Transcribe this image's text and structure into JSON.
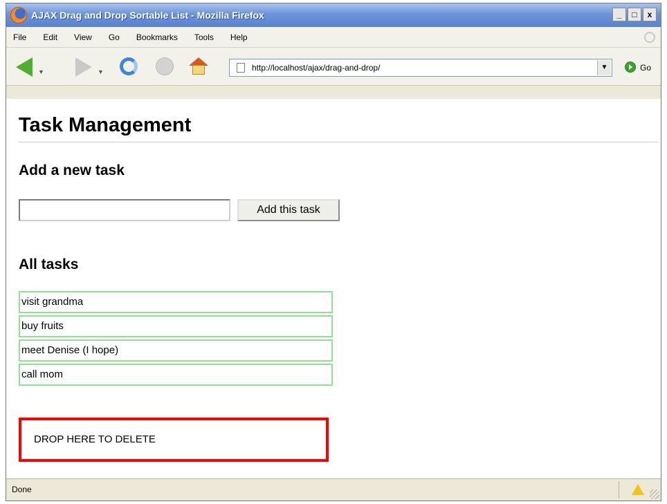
{
  "window": {
    "title": "AJAX Drag and Drop Sortable List - Mozilla Firefox",
    "minimize": "_",
    "maximize": "□",
    "close": "x"
  },
  "menu": [
    "File",
    "Edit",
    "View",
    "Go",
    "Bookmarks",
    "Tools",
    "Help"
  ],
  "toolbar": {
    "url": "http://localhost/ajax/drag-and-drop/",
    "go_label": "Go"
  },
  "page": {
    "title": "Task Management",
    "add_heading": "Add a new task",
    "task_input_value": "",
    "add_button": "Add this task",
    "all_heading": "All tasks",
    "tasks": [
      "visit grandma",
      "buy fruits",
      "meet Denise (I hope)",
      "call mom"
    ],
    "drop_zone": "DROP HERE TO DELETE"
  },
  "status": {
    "text": "Done"
  },
  "colors": {
    "task_border": "#8ee38e",
    "drop_border": "#ff0000",
    "titlebar": "#5a83cf"
  }
}
